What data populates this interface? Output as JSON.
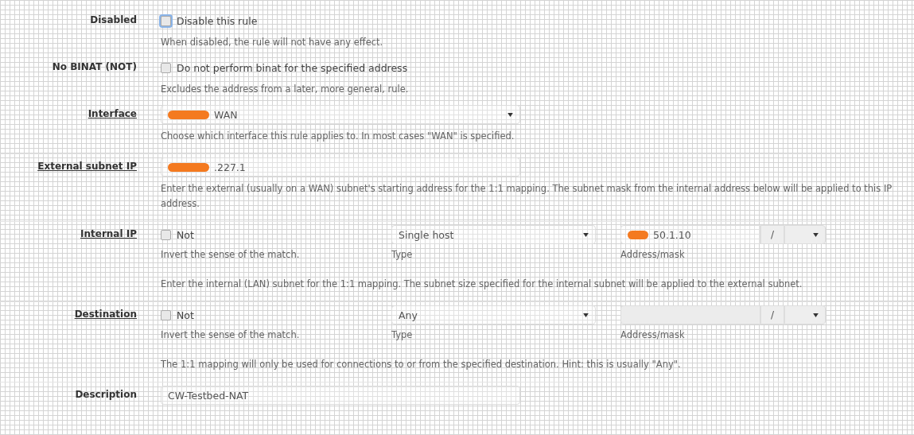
{
  "sections": [
    {
      "label": "Disabled",
      "underlined": false,
      "kind": "checkbox",
      "checkbox": {
        "label": "Disable this rule",
        "checked": false,
        "focused": true
      },
      "help": "When disabled, the rule will not have any effect."
    },
    {
      "label": "No BINAT (NOT)",
      "underlined": false,
      "kind": "checkbox",
      "checkbox": {
        "label": "Do not perform binat for the specified address",
        "checked": false,
        "focused": false
      },
      "help": "Excludes the address from a later, more general, rule."
    },
    {
      "label": "Interface",
      "underlined": true,
      "kind": "select",
      "value": "WAN",
      "redacted": true,
      "help": "Choose which interface this rule applies to. In most cases \"WAN\" is specified."
    },
    {
      "label": "External subnet IP",
      "underlined": true,
      "kind": "input",
      "value": ".227.1",
      "redacted": true,
      "help": "Enter the external (usually on a WAN) subnet's starting address for the 1:1 mapping. The subnet mask from the internal address below will be applied to this IP address."
    },
    {
      "label": "Internal IP",
      "underlined": true,
      "kind": "address",
      "not": {
        "label": "Not",
        "checked": false
      },
      "not_help": "Invert the sense of the match.",
      "type": {
        "value": "Single host",
        "caption": "Type"
      },
      "address": {
        "value": "50.1.10",
        "redacted": true,
        "disabled": false,
        "separator": "/",
        "caption": "Address/mask"
      },
      "help": "Enter the internal (LAN) subnet for the 1:1 mapping. The subnet size specified for the internal subnet will be applied to the external subnet."
    },
    {
      "label": "Destination",
      "underlined": true,
      "kind": "address",
      "not": {
        "label": "Not",
        "checked": false
      },
      "not_help": "Invert the sense of the match.",
      "type": {
        "value": "Any",
        "caption": "Type"
      },
      "address": {
        "redacted": false,
        "disabled": true,
        "separator": "/",
        "caption": "Address/mask"
      },
      "help": "The 1:1 mapping will only be used for connections to or from the specified destination. Hint: this is usually \"Any\"."
    },
    {
      "label": "Description",
      "underlined": false,
      "kind": "input",
      "value": "CW-Testbed-NAT",
      "redacted": false
    }
  ]
}
